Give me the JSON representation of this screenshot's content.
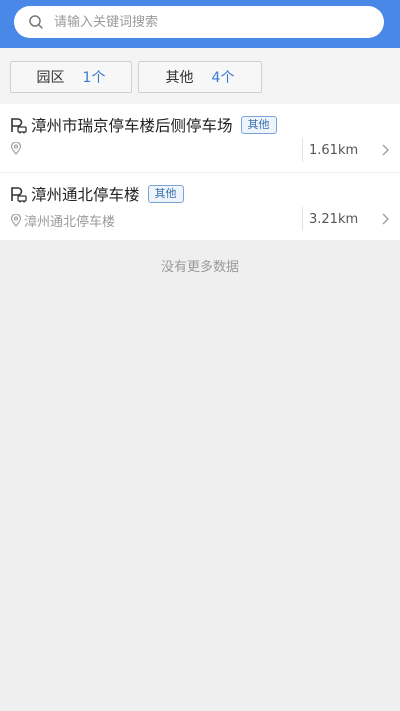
{
  "search": {
    "placeholder": "请输入关键词搜索",
    "value": ""
  },
  "filters": [
    {
      "name": "园区",
      "count": "1个"
    },
    {
      "name": "其他",
      "count": "4个"
    }
  ],
  "items": [
    {
      "title": "漳州市瑞京停车楼后侧停车场",
      "tag": "其他",
      "address": "",
      "distance": "1.61km"
    },
    {
      "title": "漳州通北停车楼",
      "tag": "其他",
      "address": "漳州通北停车楼",
      "distance": "3.21km"
    }
  ],
  "footer": {
    "no_more_text": "没有更多数据"
  },
  "colors": {
    "header": "#4a88e8",
    "accent": "#3a7bd5",
    "background": "#efefef"
  },
  "icons": [
    "search-icon",
    "parking-icon",
    "location-pin-icon",
    "chevron-right-icon"
  ]
}
